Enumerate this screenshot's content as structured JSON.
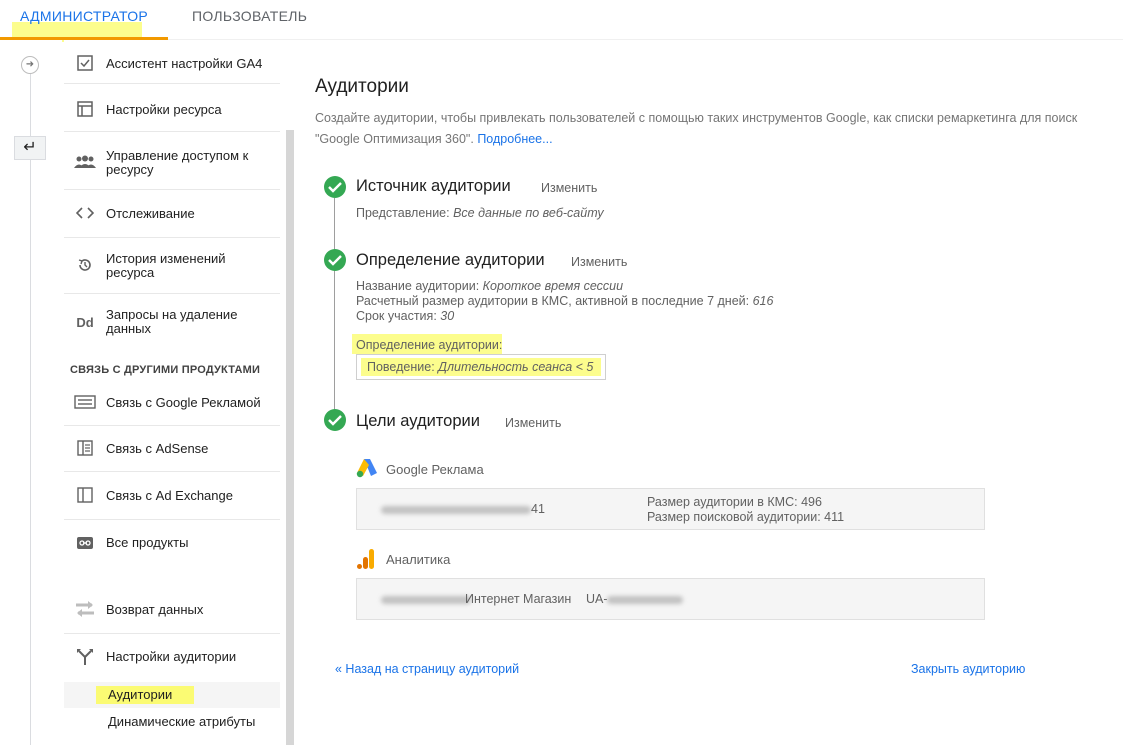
{
  "tabs": {
    "admin": "АДМИНИСТРАТОР",
    "user": "ПОЛЬЗОВАТЕЛЬ"
  },
  "nav": {
    "items": [
      {
        "label": "Ассистент настройки GA4",
        "icon": "checkbox-icon"
      },
      {
        "label": "Настройки ресурса",
        "icon": "layout-icon"
      },
      {
        "label": "Управление доступом к ресурсу",
        "icon": "people-icon"
      },
      {
        "label": "Отслеживание",
        "icon": "code-icon"
      },
      {
        "label": "История изменений ресурса",
        "icon": "history-icon"
      },
      {
        "label": "Запросы на удаление данных",
        "icon": "dd-icon"
      }
    ],
    "section_title": "СВЯЗЬ С ДРУГИМИ ПРОДУКТАМИ",
    "link_items": [
      {
        "label": "Связь с Google Рекламой",
        "icon": "ads-icon"
      },
      {
        "label": "Связь с AdSense",
        "icon": "adsense-icon"
      },
      {
        "label": "Связь с Ad Exchange",
        "icon": "adexchange-icon"
      },
      {
        "label": "Все продукты",
        "icon": "link-icon"
      }
    ],
    "data_items": [
      {
        "label": "Возврат данных",
        "icon": "data-import-icon"
      },
      {
        "label": "Настройки аудитории",
        "icon": "fork-icon"
      }
    ],
    "sub_items": [
      {
        "label": "Аудитории",
        "active": true
      },
      {
        "label": "Динамические атрибуты",
        "active": false
      }
    ],
    "dd_glyph": "Dd"
  },
  "main": {
    "title": "Аудитории",
    "description_line1": "Создайте аудитории, чтобы привлекать пользователей с помощью таких инструментов Google, как списки ремаркетинга для поиск",
    "description_line2": "\"Google Оптимизация 360\".",
    "learn_more": "Подробнее...",
    "change_label": "Изменить",
    "steps": {
      "source": {
        "title": "Источник аудитории",
        "view_label": "Представление:",
        "view_value": "Все данные по веб-сайту"
      },
      "definition": {
        "title": "Определение аудитории",
        "name_label": "Название аудитории:",
        "name_value": "Короткое время сессии",
        "size_label": "Расчетный размер аудитории в КМС, активной в последние 7 дней:",
        "size_value": "616",
        "duration_label": "Срок участия:",
        "duration_value": "30",
        "def_label": "Определение аудитории:",
        "def_key": "Поведение:",
        "def_value": "Длительность сеанса < 5"
      },
      "goals": {
        "title": "Цели аудитории",
        "google_ads": {
          "name": "Google Реклама",
          "id_suffix": "41",
          "gdn_size": "Размер аудитории в КМС: 496",
          "search_size": "Размер поисковой аудитории: 411"
        },
        "analytics": {
          "name": "Аналитика",
          "store_name": "Интернет Магазин",
          "ua_prefix": "UA-"
        }
      }
    },
    "back_link": "« Назад на страницу аудиторий",
    "close_link": "Закрыть аудиторию"
  },
  "colors": {
    "accent": "#1a73e8",
    "tab_underline": "#f29900",
    "check_green": "#34a853",
    "highlight": "#fbfc5c"
  }
}
